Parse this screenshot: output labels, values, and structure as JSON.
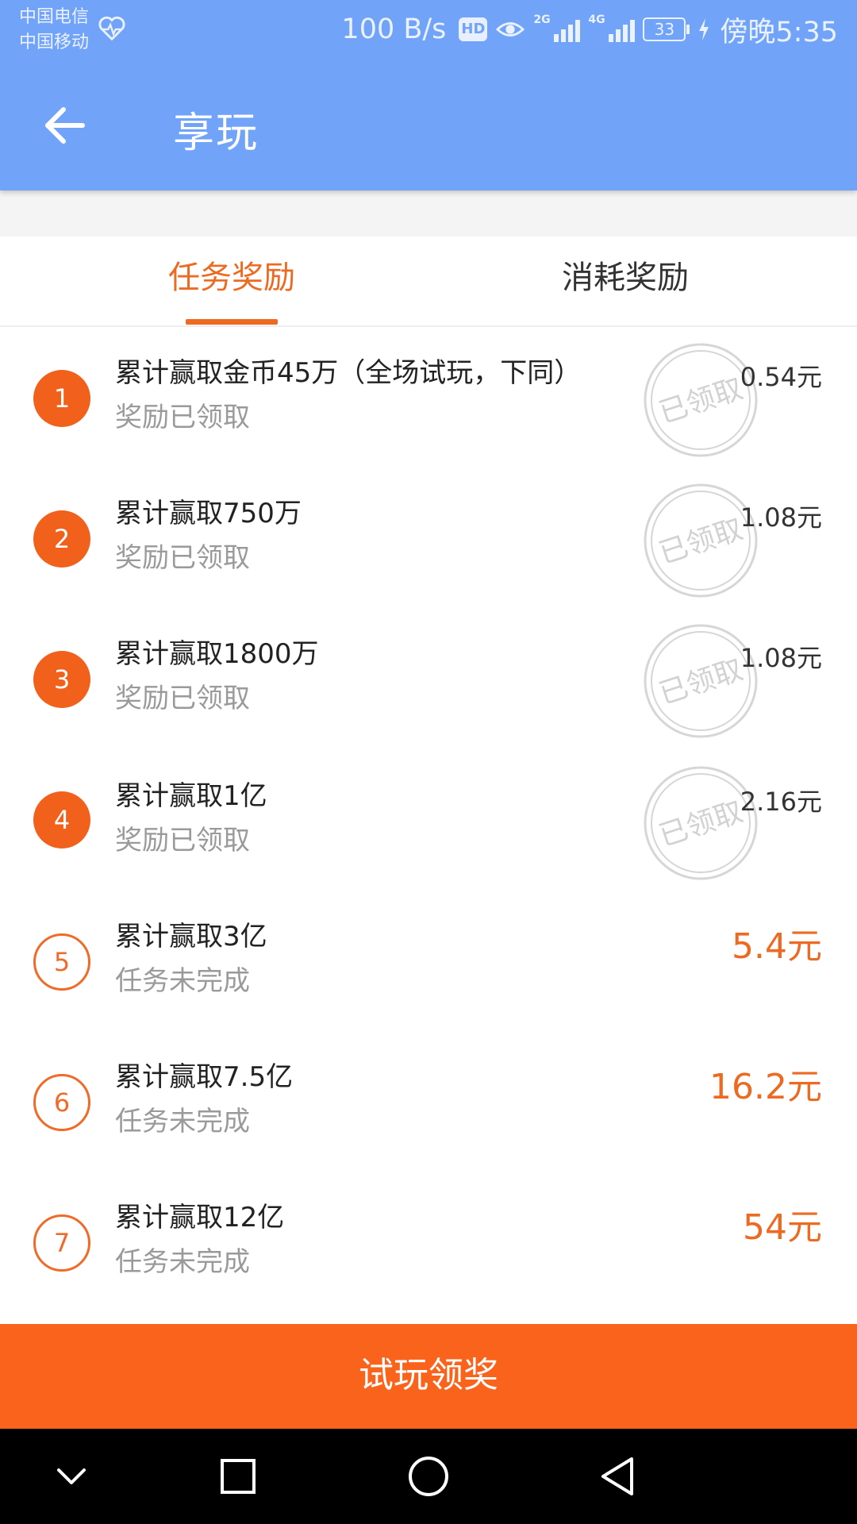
{
  "status_bar": {
    "carrier_1": "中国电信",
    "carrier_2": "中国移动",
    "net_speed": "100 B/s",
    "hd_label": "HD",
    "signal_1_tag": "2G",
    "signal_2_tag": "4G",
    "battery_level": "33",
    "time": "傍晚5:35",
    "icons": [
      "heart-icon",
      "eye-icon",
      "signal-icon",
      "battery-icon",
      "charging-icon"
    ]
  },
  "header": {
    "title": "享玩",
    "back_icon": "arrow-left-icon",
    "color": "#71a3f8"
  },
  "tabs": [
    {
      "label": "任务奖励",
      "active": true
    },
    {
      "label": "消耗奖励",
      "active": false
    }
  ],
  "tasks": [
    {
      "number": "1",
      "title": "累计赢取金币45万（全场试玩，下同）",
      "status": "奖励已领取",
      "reward": "0.54元",
      "claimed": true,
      "stamp_text": "已领取"
    },
    {
      "number": "2",
      "title": "累计赢取750万",
      "status": "奖励已领取",
      "reward": "1.08元",
      "claimed": true,
      "stamp_text": "已领取"
    },
    {
      "number": "3",
      "title": "累计赢取1800万",
      "status": "奖励已领取",
      "reward": "1.08元",
      "claimed": true,
      "stamp_text": "已领取"
    },
    {
      "number": "4",
      "title": "累计赢取1亿",
      "status": "奖励已领取",
      "reward": "2.16元",
      "claimed": true,
      "stamp_text": "已领取"
    },
    {
      "number": "5",
      "title": "累计赢取3亿",
      "status": "任务未完成",
      "reward": "5.4元",
      "claimed": false
    },
    {
      "number": "6",
      "title": "累计赢取7.5亿",
      "status": "任务未完成",
      "reward": "16.2元",
      "claimed": false
    },
    {
      "number": "7",
      "title": "累计赢取12亿",
      "status": "任务未完成",
      "reward": "54元",
      "claimed": false
    }
  ],
  "action_button": {
    "label": "试玩领奖",
    "color": "#f9631b"
  },
  "nav_bar": {
    "icons": [
      "chevron-down-icon",
      "recents-square-icon",
      "home-circle-icon",
      "back-triangle-icon"
    ]
  },
  "colors": {
    "accent": "#ec6a21",
    "header": "#71a3f8"
  }
}
